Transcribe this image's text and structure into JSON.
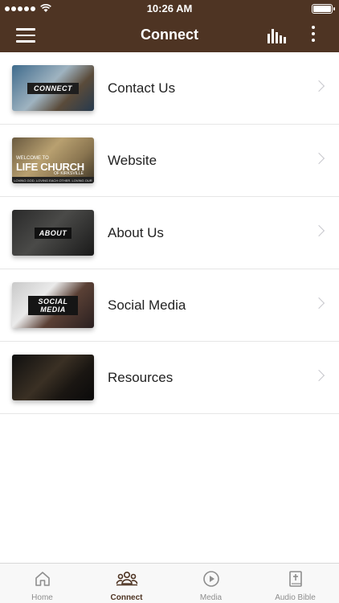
{
  "status_bar": {
    "time": "10:26 AM"
  },
  "nav": {
    "title": "Connect"
  },
  "thumb_text": {
    "contact": "CONNECT",
    "about": "ABOUT",
    "social": "SOCIAL MEDIA",
    "website_small": "WELCOME TO",
    "website_big": "LIFE CHURCH",
    "website_sub": "OF KIRKSVILLE",
    "website_strip": "LOVING GOD. LOVING EACH OTHER. LOVING OUR WORLD."
  },
  "items": [
    {
      "label": "Contact Us"
    },
    {
      "label": "Website"
    },
    {
      "label": "About Us"
    },
    {
      "label": "Social Media"
    },
    {
      "label": "Resources"
    }
  ],
  "tabs": [
    {
      "label": "Home",
      "icon": "home-icon"
    },
    {
      "label": "Connect",
      "icon": "people-icon"
    },
    {
      "label": "Media",
      "icon": "play-circle-icon"
    },
    {
      "label": "Audio Bible",
      "icon": "bible-icon"
    }
  ],
  "colors": {
    "brand": "#4e3423",
    "inactive": "#8e8e8e",
    "chevron": "#c7c7cc"
  }
}
